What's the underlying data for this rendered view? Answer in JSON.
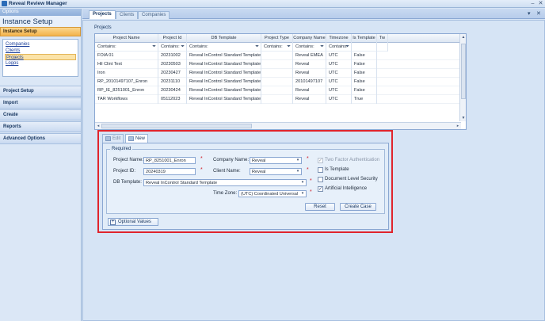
{
  "app": {
    "title": "Reveal Review Manager"
  },
  "sidebar": {
    "options_label": "Options",
    "section_title": "Instance Setup",
    "active_nav": "Instance Setup",
    "sublinks": [
      {
        "label": "Companies"
      },
      {
        "label": "Clients"
      },
      {
        "label": "Projects",
        "selected": true
      },
      {
        "label": "Logos"
      }
    ],
    "groups": [
      "Project Setup",
      "Import",
      "Create",
      "Reports",
      "Advanced Options"
    ]
  },
  "tabs": [
    {
      "label": "Projects",
      "active": true
    },
    {
      "label": "Clients"
    },
    {
      "label": "Companies"
    }
  ],
  "projects": {
    "section_label": "Projects",
    "columns": [
      "Project Name",
      "Project Id",
      "DB Template",
      "Project Type",
      "Company Name",
      "Timezone",
      "Is Template",
      "Tw"
    ],
    "filter_text": "Contains:",
    "rows": [
      [
        "FOIA 01",
        "20231002",
        "Reveal InControl Standard Template",
        "",
        "Reveal EMEA",
        "UTC",
        "False"
      ],
      [
        "Hil Clint Text",
        "20230503",
        "Reveal InControl Standard Template",
        "",
        "Reveal",
        "UTC",
        "False"
      ],
      [
        "Iron",
        "20230427",
        "Reveal InControl Standard Template",
        "",
        "Reveal",
        "UTC",
        "False"
      ],
      [
        "RP_20101497107_Enron",
        "20231110",
        "Reveal InControl Standard Template",
        "",
        "20101497107",
        "UTC",
        "False"
      ],
      [
        "RP_IE_8251001_Enron",
        "20230424",
        "Reveal InControl Standard Template",
        "",
        "Reveal",
        "UTC",
        "False"
      ],
      [
        "TAR Workflows",
        "05112023",
        "Reveal InControl Standard Template",
        "",
        "Reveal",
        "UTC",
        "True"
      ]
    ]
  },
  "editor": {
    "tab_edit": "Edit",
    "tab_new": "New",
    "group_label": "Required",
    "project_name_label": "Project Name:",
    "project_name_value": "RP_8251001_Enron",
    "project_id_label": "Project ID:",
    "project_id_value": "20240319",
    "db_template_label": "DB Template:",
    "db_template_value": "Reveal InControl Standard Template",
    "company_name_label": "Company Name:",
    "company_name_value": "Reveal",
    "client_name_label": "Client Name:",
    "client_name_value": "Reveal",
    "time_zone_label": "Time Zone:",
    "time_zone_value": "(UTC) Coordinated Universal",
    "checkboxes": [
      {
        "label": "Two Factor Authentication",
        "checked": true,
        "disabled": true
      },
      {
        "label": "Is Template",
        "checked": false
      },
      {
        "label": "Document Level Security",
        "checked": false
      },
      {
        "label": "Artificial Intelligence",
        "checked": true
      }
    ],
    "reset_label": "Reset",
    "create_label": "Create Case",
    "optional_label": "Optional Values"
  },
  "colors": {
    "highlight": "#e0242c",
    "accent": "#f3b24a",
    "panel": "#d6e4f5"
  }
}
